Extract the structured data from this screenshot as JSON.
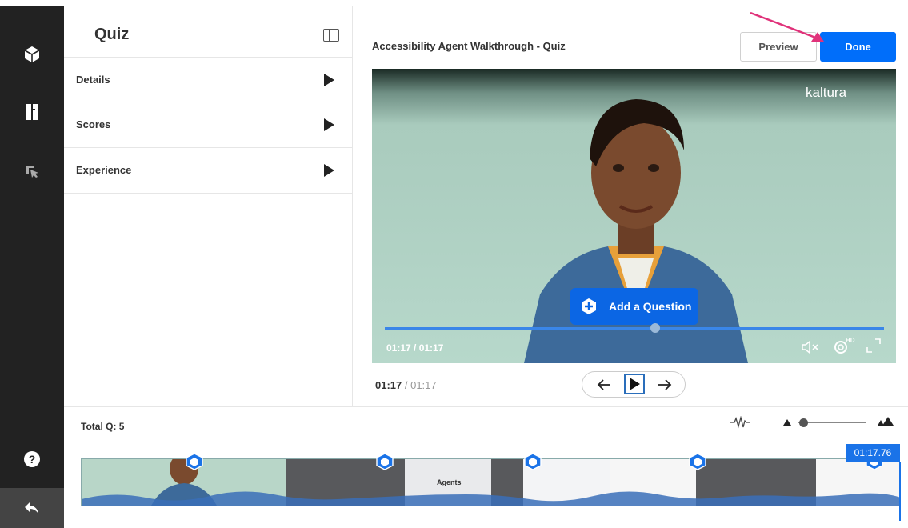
{
  "panel": {
    "title": "Quiz",
    "sections": [
      {
        "label": "Details"
      },
      {
        "label": "Scores"
      },
      {
        "label": "Experience"
      }
    ]
  },
  "header": {
    "media_title": "Accessibility Agent Walkthrough - Quiz",
    "preview_label": "Preview",
    "done_label": "Done"
  },
  "player": {
    "brand": "kaltura",
    "time_display": "01:17 / 01:17",
    "add_question_label": "Add a Question",
    "progress_fraction": 1.0
  },
  "playback": {
    "current": "01:17",
    "separator": " / ",
    "duration": "01:17"
  },
  "timeline": {
    "total_questions": "Total Q: 5",
    "playhead_time": "01:17.76",
    "thumbnail_text": "Agents",
    "cue_count": 5
  },
  "colors": {
    "accent": "#006efa",
    "rail": "#222222",
    "cue": "#1a73e8"
  },
  "icons": {
    "rail": [
      "cube-icon",
      "book-icon",
      "cursor-icon",
      "help-icon",
      "back-icon"
    ],
    "player": [
      "volume-mute-icon",
      "settings-hd-icon",
      "fullscreen-icon"
    ],
    "timeline": [
      "waveform-icon",
      "zoom-out-icon",
      "zoom-in-icon"
    ]
  }
}
